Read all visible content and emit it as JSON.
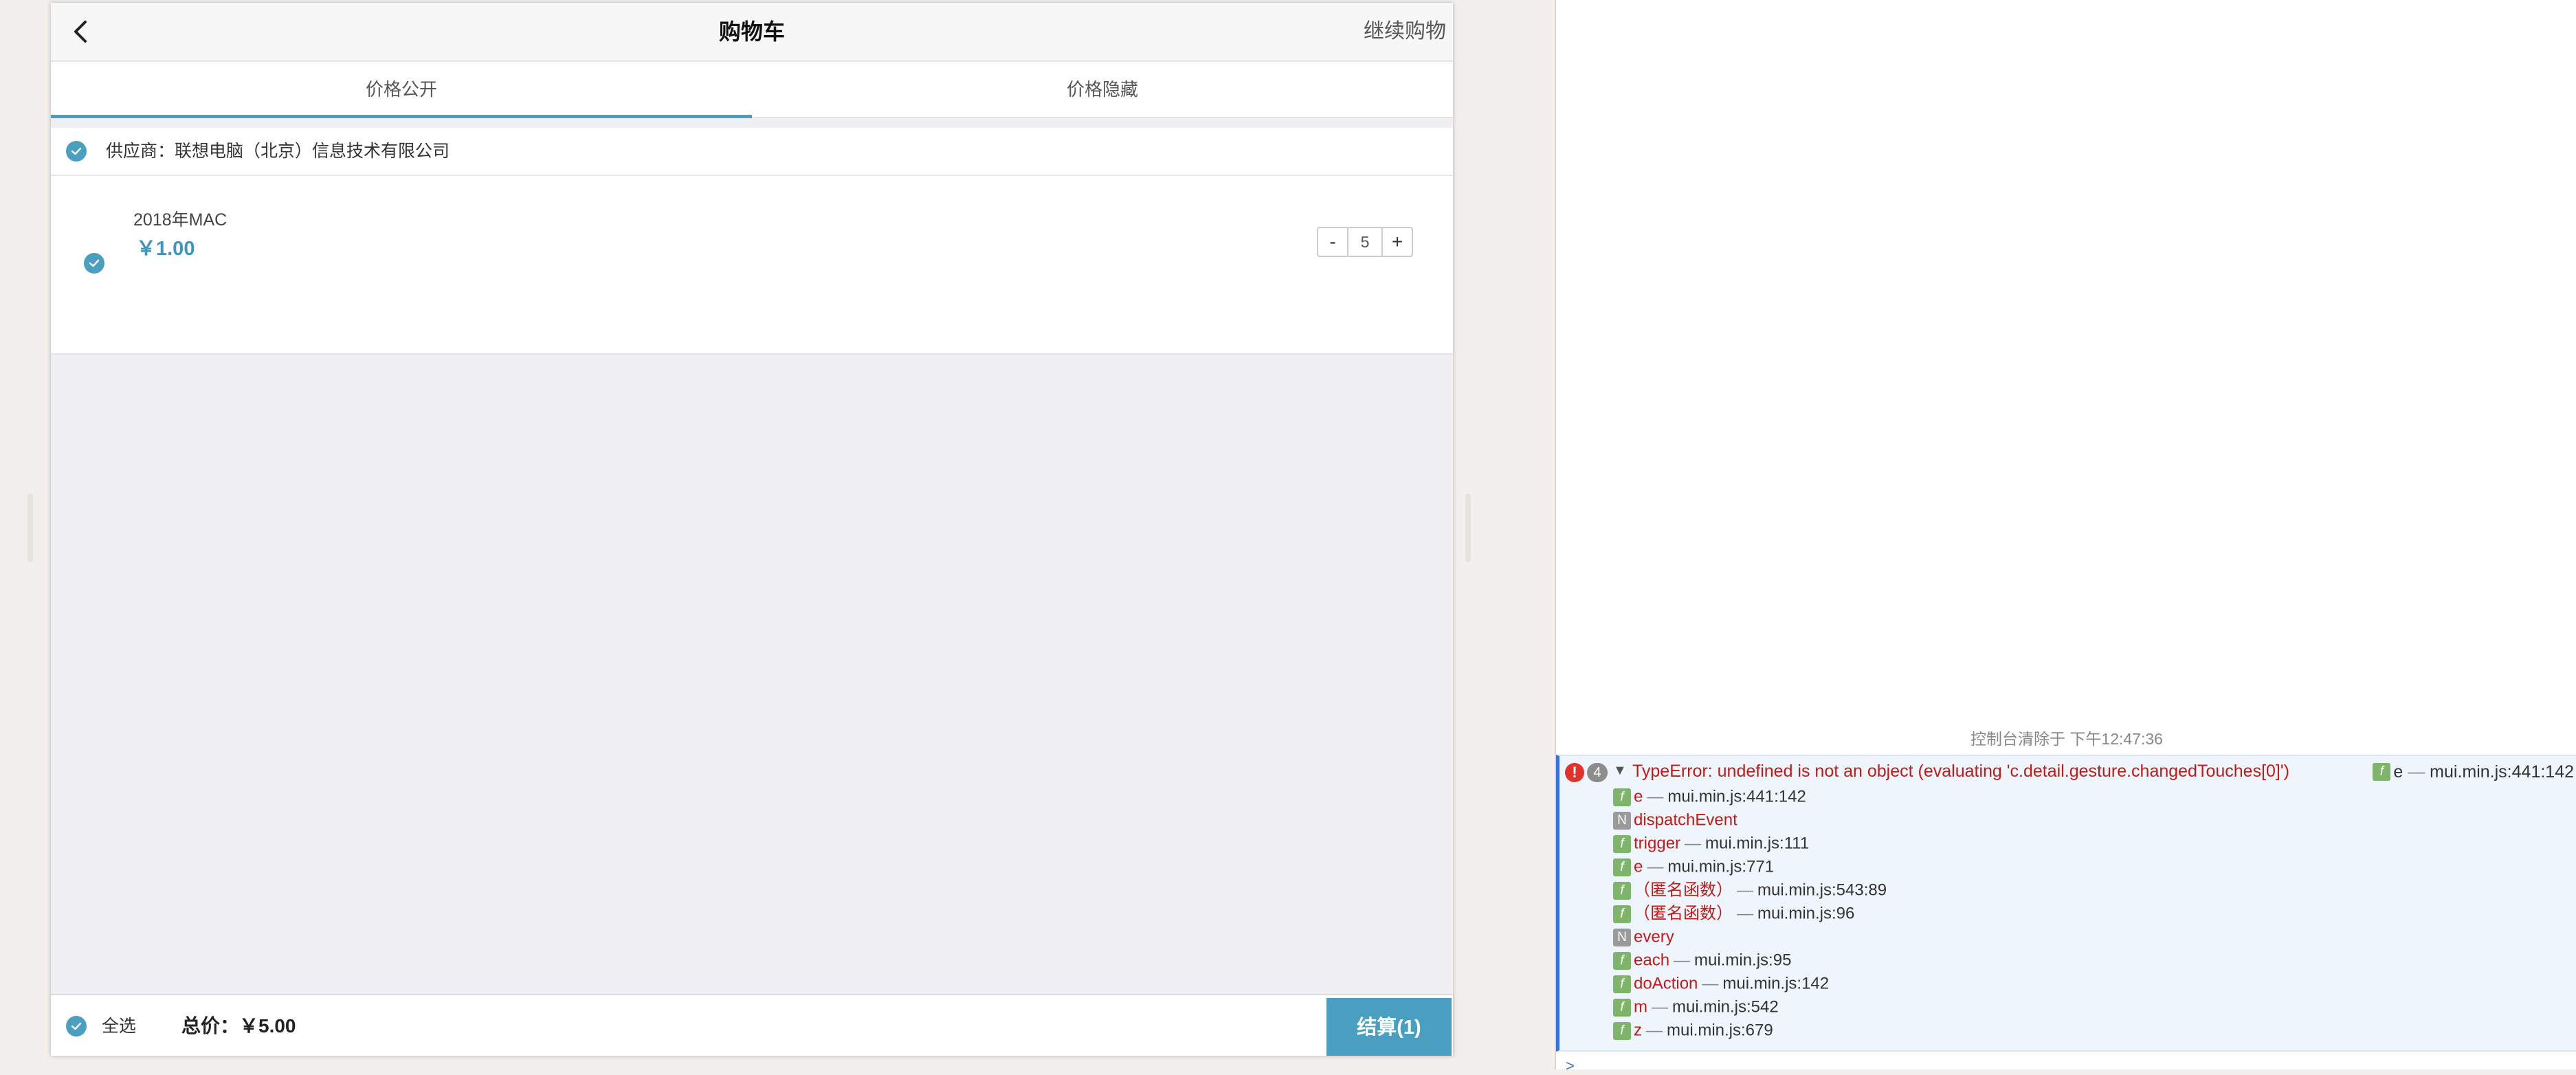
{
  "navbar": {
    "title": "购物车",
    "right": "继续购物"
  },
  "tabs": [
    {
      "label": "价格公开",
      "active": true
    },
    {
      "label": "价格隐藏",
      "active": false
    }
  ],
  "supplier": {
    "label": "供应商：联想电脑（北京）信息技术有限公司"
  },
  "item": {
    "name": "2018年MAC",
    "price": "￥1.00",
    "quantity": "5",
    "minus": "-",
    "plus": "+"
  },
  "footer": {
    "select_all": "全选",
    "total": "总价：￥5.00",
    "checkout": "结算(1)"
  },
  "console": {
    "cleared": "控制台清除于 下午12:47:36",
    "error": {
      "icon": "!",
      "count": "4",
      "message": "TypeError: undefined is not an object (evaluating 'c.detail.gesture.changedTouches[0]')",
      "location_fn": "e",
      "location_src": "mui.min.js:441:142"
    },
    "frames": [
      {
        "type": "f",
        "fn": "e",
        "src": "mui.min.js:441:142"
      },
      {
        "type": "n",
        "fn": "dispatchEvent",
        "src": ""
      },
      {
        "type": "f",
        "fn": "trigger",
        "src": "mui.min.js:111"
      },
      {
        "type": "f",
        "fn": "e",
        "src": "mui.min.js:771"
      },
      {
        "type": "f",
        "fn": "（匿名函数）",
        "src": "mui.min.js:543:89"
      },
      {
        "type": "f",
        "fn": "（匿名函数）",
        "src": "mui.min.js:96"
      },
      {
        "type": "n",
        "fn": "every",
        "src": ""
      },
      {
        "type": "f",
        "fn": "each",
        "src": "mui.min.js:95"
      },
      {
        "type": "f",
        "fn": "doAction",
        "src": "mui.min.js:142"
      },
      {
        "type": "f",
        "fn": "m",
        "src": "mui.min.js:542"
      },
      {
        "type": "f",
        "fn": "z",
        "src": "mui.min.js:679"
      }
    ],
    "separator": "—",
    "prompt": ">"
  },
  "colors": {
    "accent": "#4a9fc0",
    "error": "#c41a16",
    "price": "#3d97bd"
  },
  "icons": {
    "back": "chevron-left-icon",
    "check": "check-circle-icon"
  }
}
